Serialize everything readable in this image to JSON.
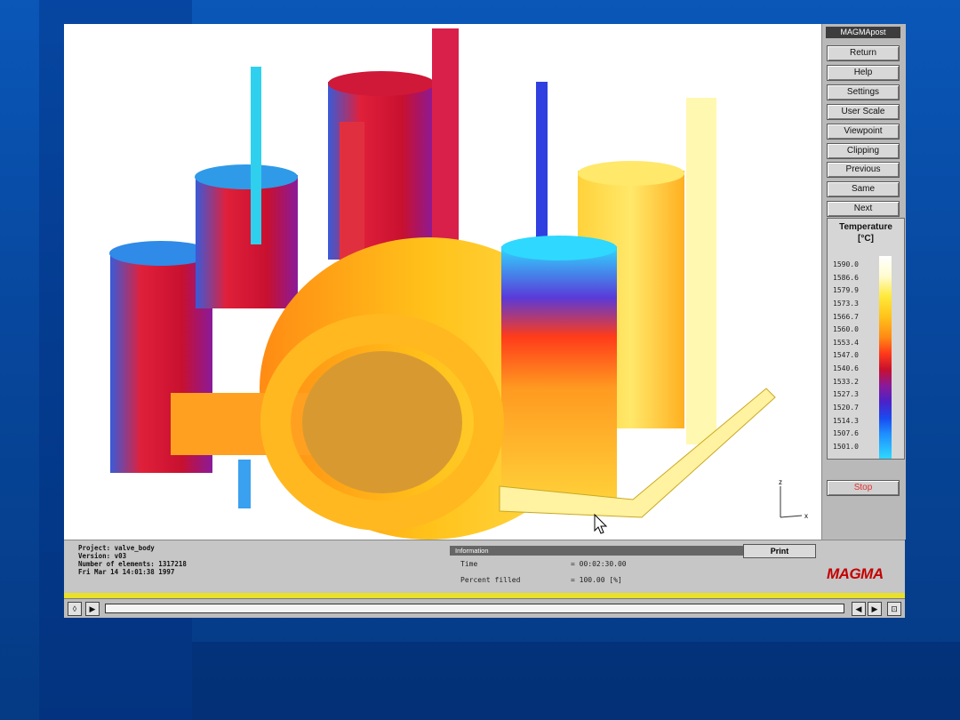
{
  "panel": {
    "title": "MAGMApost",
    "buttons": [
      "Return",
      "Help",
      "Settings",
      "User Scale",
      "Viewpoint",
      "Clipping",
      "Previous",
      "Same",
      "Next"
    ],
    "stop_label": "Stop"
  },
  "legend": {
    "title": "Temperature",
    "unit": "[°C]",
    "values": [
      "1590.0",
      "1586.6",
      "1579.9",
      "1573.3",
      "1566.7",
      "1560.0",
      "1553.4",
      "1547.0",
      "1540.6",
      "1533.2",
      "1527.3",
      "1520.7",
      "1514.3",
      "1507.6",
      "1501.0"
    ]
  },
  "info": {
    "project_lines": [
      "Project: valve_body",
      "Version: v03",
      "Number of elements: 1317218",
      "Fri Mar 14 14:01:38 1997"
    ],
    "header": "Information",
    "print_label": "Print",
    "time_label": "Time",
    "time_value": "= 00:02:30.00",
    "fill_label": "Percent filled",
    "fill_value": "=     100.00 [%]",
    "logo": "MAGMA"
  },
  "axis": {
    "z": "z",
    "x": "x"
  },
  "colors": {
    "hot": "#ffffff",
    "mid": "#ffc21a",
    "cold": "#2fd8ff",
    "stop": "#e03030",
    "logo": "#c40000"
  }
}
